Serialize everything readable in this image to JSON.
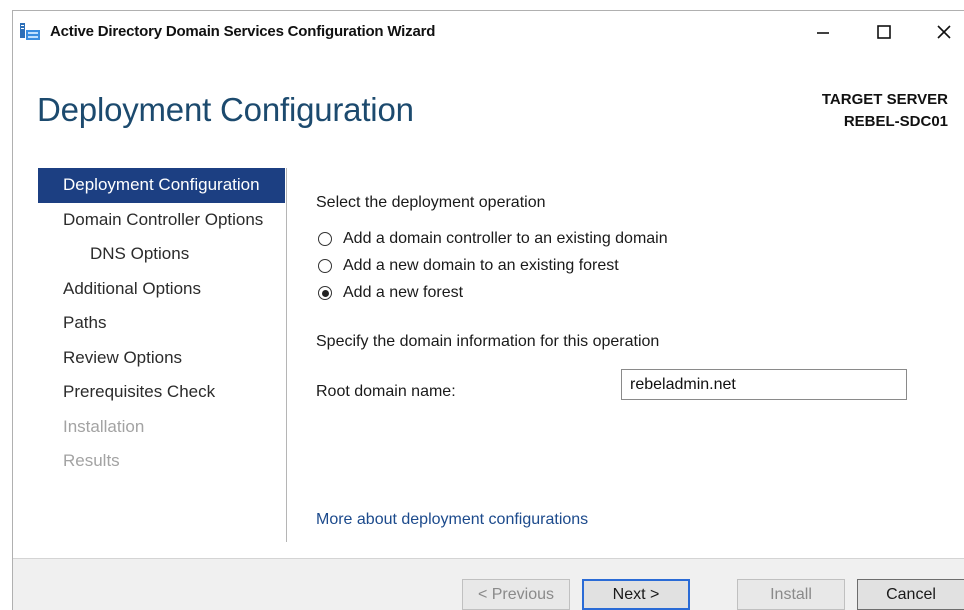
{
  "window": {
    "title": "Active Directory Domain Services Configuration Wizard",
    "app_icon": "ad-ds-icon",
    "controls": [
      "minimize-icon",
      "maximize-icon",
      "close-icon"
    ]
  },
  "header": {
    "page_title": "Deployment Configuration",
    "target_label": "TARGET SERVER",
    "target_name": "REBEL-SDC01"
  },
  "sidebar": {
    "items": [
      {
        "label": "Deployment Configuration",
        "state": "active"
      },
      {
        "label": "Domain Controller Options",
        "state": "normal"
      },
      {
        "label": "DNS Options",
        "state": "sub"
      },
      {
        "label": "Additional Options",
        "state": "normal"
      },
      {
        "label": "Paths",
        "state": "normal"
      },
      {
        "label": "Review Options",
        "state": "normal"
      },
      {
        "label": "Prerequisites Check",
        "state": "normal"
      },
      {
        "label": "Installation",
        "state": "disabled"
      },
      {
        "label": "Results",
        "state": "disabled"
      }
    ]
  },
  "main": {
    "deployment_heading": "Select the deployment operation",
    "options": [
      {
        "label": "Add a domain controller to an existing domain",
        "selected": false
      },
      {
        "label": "Add a new domain to an existing forest",
        "selected": false
      },
      {
        "label": "Add a new forest",
        "selected": true
      }
    ],
    "domain_heading": "Specify the domain information for this operation",
    "root_domain_label": "Root domain name:",
    "root_domain_value": "rebeladmin.net",
    "more_link": "More about deployment configurations"
  },
  "footer": {
    "previous": "< Previous",
    "next": "Next >",
    "install": "Install",
    "cancel": "Cancel"
  },
  "colors": {
    "accent": "#1c3f82",
    "title_blue": "#1c4a6e",
    "link_blue": "#1c4a8c",
    "disabled": "#a3a3a3"
  }
}
